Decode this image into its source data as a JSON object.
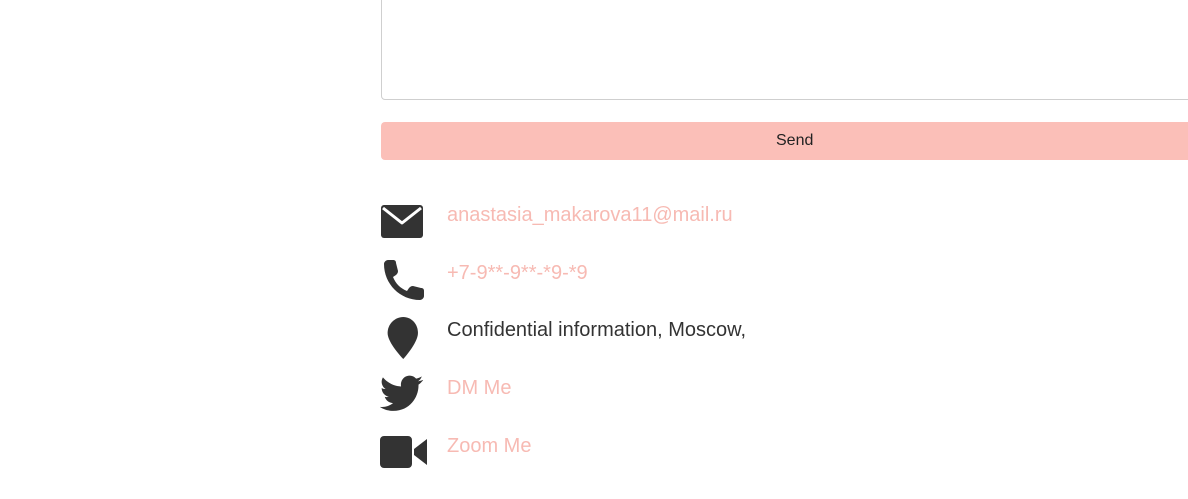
{
  "form": {
    "message_value": "",
    "send_label": "Send"
  },
  "contacts": {
    "email": "anastasia_makarova11@mail.ru",
    "phone": "+7-9**-9**-*9-*9",
    "address": "Confidential information, Moscow,",
    "twitter": "DM Me",
    "zoom": "Zoom Me"
  },
  "colors": {
    "accent": "#fbbfb8",
    "link": "#f7bab3",
    "icon": "#333333",
    "text": "#333333"
  },
  "icons": [
    "envelope-icon",
    "phone-icon",
    "map-pin-icon",
    "twitter-icon",
    "video-camera-icon"
  ]
}
